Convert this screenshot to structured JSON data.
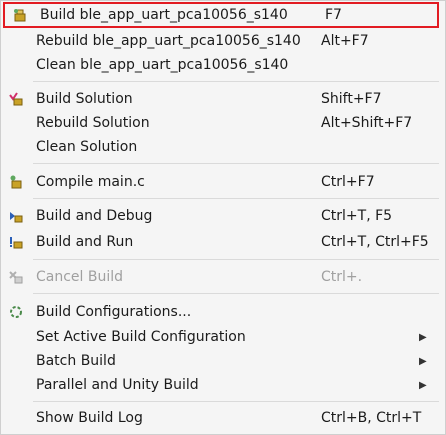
{
  "menu": {
    "items": [
      {
        "label": "Build ble_app_uart_pca10056_s140",
        "shortcut": "F7"
      },
      {
        "label": "Rebuild ble_app_uart_pca10056_s140",
        "shortcut": "Alt+F7"
      },
      {
        "label": "Clean ble_app_uart_pca10056_s140",
        "shortcut": ""
      },
      {
        "label": "Build Solution",
        "shortcut": "Shift+F7"
      },
      {
        "label": "Rebuild Solution",
        "shortcut": "Alt+Shift+F7"
      },
      {
        "label": "Clean Solution",
        "shortcut": ""
      },
      {
        "label": "Compile main.c",
        "shortcut": "Ctrl+F7"
      },
      {
        "label": "Build and Debug",
        "shortcut": "Ctrl+T, F5"
      },
      {
        "label": "Build and Run",
        "shortcut": "Ctrl+T, Ctrl+F5"
      },
      {
        "label": "Cancel Build",
        "shortcut": "Ctrl+."
      },
      {
        "label": "Build Configurations...",
        "shortcut": ""
      },
      {
        "label": "Set Active Build Configuration",
        "shortcut": ""
      },
      {
        "label": "Batch Build",
        "shortcut": ""
      },
      {
        "label": "Parallel and Unity Build",
        "shortcut": ""
      },
      {
        "label": "Show Build Log",
        "shortcut": "Ctrl+B, Ctrl+T"
      }
    ]
  },
  "colors": {
    "highlight_border": "#e21b22",
    "disabled_text": "#a0a0a0",
    "menu_bg": "#f5f5f5"
  },
  "icons": {
    "build": "build-icon",
    "build_solution": "build-solution-icon",
    "compile": "compile-icon",
    "build_and_debug": "build-and-debug-icon",
    "build_and_run": "build-and-run-icon",
    "cancel_build": "cancel-build-icon",
    "build_configurations": "build-configurations-icon",
    "submenu": "chevron-right-icon"
  }
}
